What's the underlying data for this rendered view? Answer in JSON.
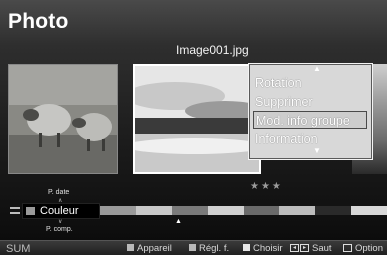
{
  "header": {
    "title": "Photo",
    "filename": "Image001.jpg"
  },
  "rating": {
    "stars": "★★★"
  },
  "popup_menu": {
    "items": [
      {
        "label": "Rotation",
        "selected": false
      },
      {
        "label": "Supprimer",
        "selected": false
      },
      {
        "label": "Mod. info groupe",
        "selected": true
      },
      {
        "label": "Information",
        "selected": false
      }
    ],
    "scroll_up_glyph": "▲",
    "scroll_down_glyph": "▼"
  },
  "sort_widget": {
    "prev_option": "P. date",
    "current_option": "Couleur",
    "next_option": "P. comp."
  },
  "color_band": {
    "segments": [
      "#9a9a9a",
      "#c8c8c8",
      "#7a7a7a",
      "#d0d0d0",
      "#6a6a6a",
      "#bcbcbc",
      "#2a2a2a",
      "#d8d8d8"
    ]
  },
  "bottom_bar": {
    "sum_label": "SUM",
    "items": [
      {
        "key_color": "#b9b9b9",
        "label": "Appareil"
      },
      {
        "key_color": "#b9b9b9",
        "label": "Régl. f."
      },
      {
        "key_color": "#e6e6e6",
        "label": "Choisir"
      },
      {
        "label": "Saut",
        "icons": [
          "rewind-icon",
          "fast-forward-icon"
        ]
      },
      {
        "label": "Option",
        "icons": [
          "tools-icon"
        ]
      }
    ]
  },
  "colors": {
    "popup_bg": "#d8d8d8",
    "selected_border": "#4a4a4a"
  }
}
